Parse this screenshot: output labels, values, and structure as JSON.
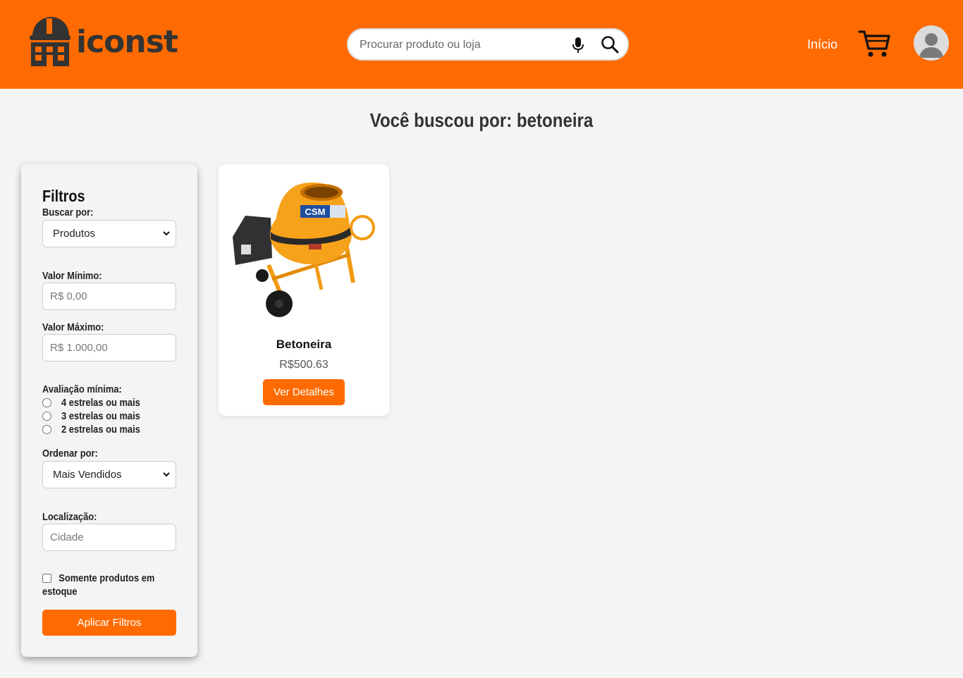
{
  "header": {
    "brand": "iconst",
    "search_placeholder": "Procurar produto ou loja",
    "nav_home": "Início",
    "icons": [
      "logo-icon",
      "mic-icon",
      "search-icon",
      "cart-icon",
      "user-avatar-icon"
    ],
    "background": "#ff6b00"
  },
  "page": {
    "title": "Você buscou por: betoneira"
  },
  "filters": {
    "title": "Filtros",
    "search_by_label": "Buscar por:",
    "search_by_value": "Produtos",
    "min_value_label": "Valor Mínimo:",
    "min_value_placeholder": "R$ 0,00",
    "max_value_label": "Valor Máximo:",
    "max_value_placeholder": "R$ 1.000,00",
    "rating_label": "Avaliação mínima:",
    "rating_options": [
      "4 estrelas ou mais",
      "3 estrelas ou mais",
      "2 estrelas ou mais"
    ],
    "order_label": "Ordenar por:",
    "order_value": "Mais Vendidos",
    "location_label": "Localização:",
    "location_placeholder": "Cidade",
    "stock_only_label": "Somente produtos em estoque",
    "apply_label": "Aplicar Filtros"
  },
  "results": [
    {
      "name": "Betoneira",
      "price": "R$500.63",
      "button_label": "Ver Detalhes",
      "image_brand": "CSM"
    }
  ],
  "colors": {
    "accent": "#ff6b00",
    "background": "#f4f4f4",
    "logo_dark": "#333333"
  }
}
